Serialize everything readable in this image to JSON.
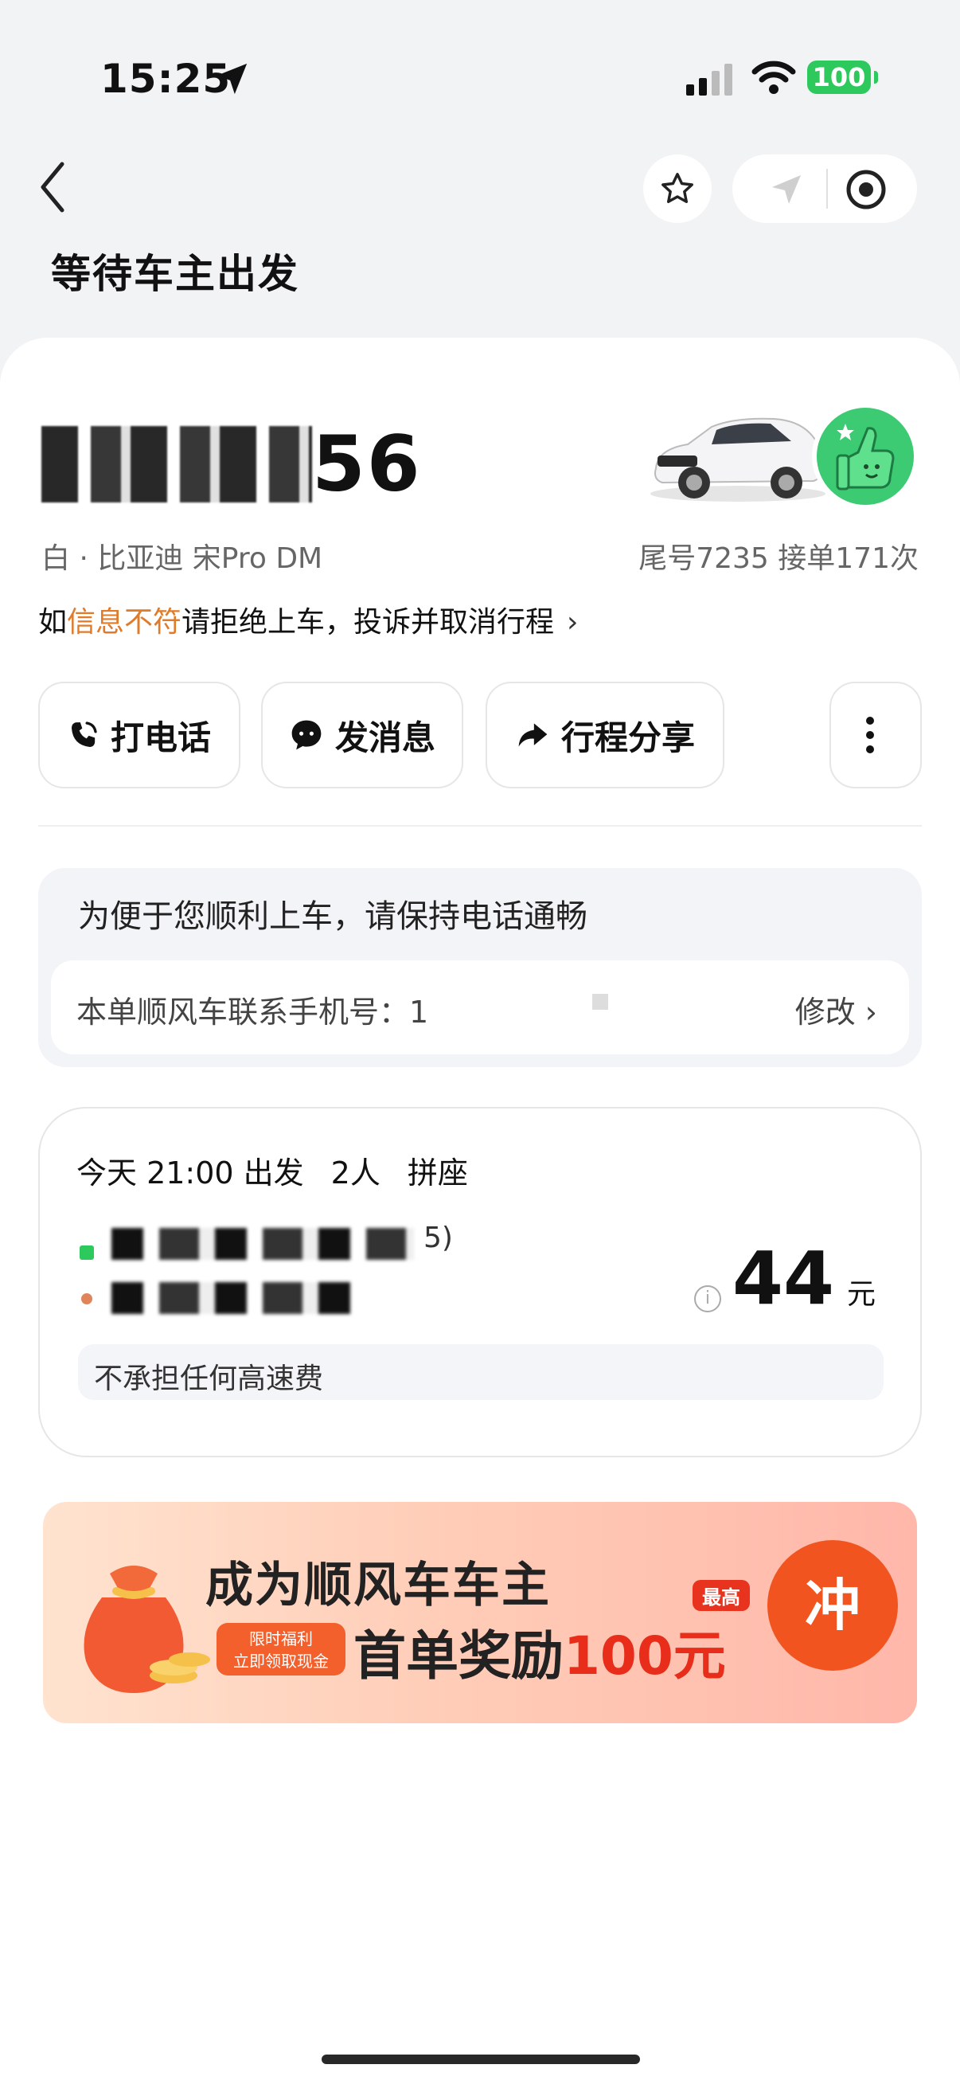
{
  "status_bar": {
    "time": "15:25",
    "battery": "100"
  },
  "header": {
    "title": "等待车主出发"
  },
  "driver": {
    "plate_suffix": "56",
    "car_desc": "白 · 比亚迪 宋Pro DM",
    "car_stats": "尾号7235 接单171次",
    "warning_prefix": "如",
    "warning_highlight": "信息不符",
    "warning_suffix": "请拒绝上车，投诉并取消行程",
    "warning_chevron": "›"
  },
  "actions": {
    "call": "打电话",
    "message": "发消息",
    "share": "行程分享"
  },
  "notice": {
    "text": "为便于您顺利上车，请保持电话通畅",
    "phone_label": "本单顺风车联系手机号：1",
    "edit": "修改 ›"
  },
  "trip": {
    "depart_time": "今天 21:00 出发",
    "passengers": "2人",
    "mode": "拼座",
    "addr1_tail": "5)",
    "price": "44",
    "price_unit": "元",
    "price_info": "i",
    "toll_note": "不承担任何高速费"
  },
  "banner": {
    "title": "成为顺风车车主",
    "tag_line1": "限时福利",
    "tag_line2": "立即领取现金",
    "sub_prefix": "首单奖励",
    "amount": "100元",
    "badge": "最高",
    "cta": "冲"
  },
  "colors": {
    "accent_green": "#2ec95c",
    "highlight_orange": "#e07b2a",
    "cta_orange": "#f2541f"
  }
}
